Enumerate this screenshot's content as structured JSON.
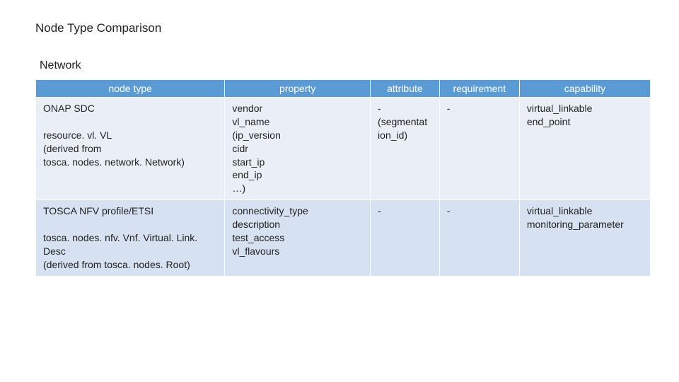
{
  "title": "Node Type Comparison",
  "subtitle": "Network",
  "headers": {
    "nodetype": "node type",
    "property": "property",
    "attribute": "attribute",
    "requirement": "requirement",
    "capability": "capability"
  },
  "rows": [
    {
      "nodetype": [
        "ONAP SDC",
        "",
        "resource. vl. VL",
        "(derived from",
        "tosca. nodes. network. Network)"
      ],
      "property": [
        "vendor",
        "vl_name",
        "(ip_version",
        "cidr",
        "start_ip",
        "end_ip",
        "…)"
      ],
      "attribute": [
        "-",
        "(segmentat",
        "ion_id)"
      ],
      "requirement": [
        "-"
      ],
      "capability": [
        "virtual_linkable",
        "end_point"
      ]
    },
    {
      "nodetype": [
        "TOSCA NFV profile/ETSI",
        "",
        "tosca. nodes. nfv. Vnf. Virtual. Link. Desc",
        "(derived from tosca. nodes. Root)"
      ],
      "property": [
        "connectivity_type",
        "description",
        "test_access",
        "vl_flavours"
      ],
      "attribute": [
        "-"
      ],
      "requirement": [
        "-"
      ],
      "capability": [
        "virtual_linkable",
        "monitoring_parameter"
      ]
    }
  ]
}
